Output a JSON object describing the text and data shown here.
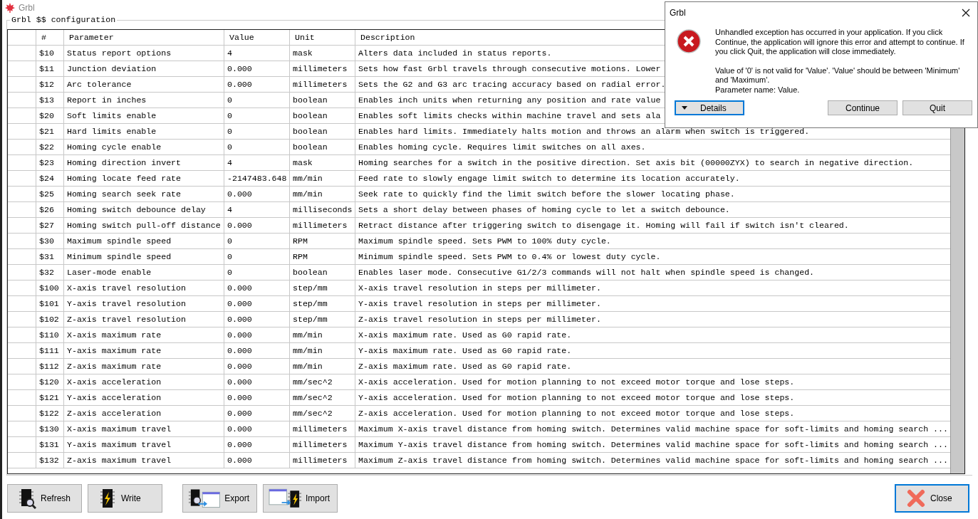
{
  "window": {
    "title": "Grbl"
  },
  "group_title": "Grbl $$ configuration",
  "table": {
    "columns": [
      "#",
      "Parameter",
      "Value",
      "Unit",
      "Description"
    ],
    "rows": [
      {
        "num": "$10",
        "parameter": "Status report options",
        "value": "4",
        "unit": "mask",
        "description": "Alters data included in status reports."
      },
      {
        "num": "$11",
        "parameter": "Junction deviation",
        "value": "0.000",
        "unit": "millimeters",
        "description": "Sets how fast Grbl travels through consecutive motions. Lower"
      },
      {
        "num": "$12",
        "parameter": "Arc tolerance",
        "value": "0.000",
        "unit": "millimeters",
        "description": "Sets the G2 and G3 arc tracing accuracy based on radial error."
      },
      {
        "num": "$13",
        "parameter": "Report in inches",
        "value": "0",
        "unit": "boolean",
        "description": "Enables inch units when returning any position and rate value"
      },
      {
        "num": "$20",
        "parameter": "Soft limits enable",
        "value": "0",
        "unit": "boolean",
        "description": "Enables soft limits checks within machine travel and sets ala"
      },
      {
        "num": "$21",
        "parameter": "Hard limits enable",
        "value": "0",
        "unit": "boolean",
        "description": "Enables hard limits. Immediately halts motion and throws an alarm when switch is triggered."
      },
      {
        "num": "$22",
        "parameter": "Homing cycle enable",
        "value": "0",
        "unit": "boolean",
        "description": "Enables homing cycle. Requires limit switches on all axes."
      },
      {
        "num": "$23",
        "parameter": "Homing direction invert",
        "value": "4",
        "unit": "mask",
        "description": "Homing searches for a switch in the positive direction. Set axis bit (00000ZYX) to search in negative direction."
      },
      {
        "num": "$24",
        "parameter": "Homing locate feed rate",
        "value": "-2147483.648",
        "unit": "mm/min",
        "description": "Feed rate to slowly engage limit switch to determine its location accurately."
      },
      {
        "num": "$25",
        "parameter": "Homing search seek rate",
        "value": "0.000",
        "unit": "mm/min",
        "description": "Seek rate to quickly find the limit switch before the slower locating phase."
      },
      {
        "num": "$26",
        "parameter": "Homing switch debounce delay",
        "value": "4",
        "unit": "milliseconds",
        "description": "Sets a short delay between phases of homing cycle to let a switch debounce."
      },
      {
        "num": "$27",
        "parameter": "Homing switch pull-off distance",
        "value": "0.000",
        "unit": "millimeters",
        "description": "Retract distance after triggering switch to disengage it. Homing will fail if switch isn't cleared."
      },
      {
        "num": "$30",
        "parameter": "Maximum spindle speed",
        "value": "0",
        "unit": "RPM",
        "description": "Maximum spindle speed. Sets PWM to 100% duty cycle."
      },
      {
        "num": "$31",
        "parameter": "Minimum spindle speed",
        "value": "0",
        "unit": "RPM",
        "description": "Minimum spindle speed. Sets PWM to 0.4% or lowest duty cycle."
      },
      {
        "num": "$32",
        "parameter": "Laser-mode enable",
        "value": "0",
        "unit": "boolean",
        "description": "Enables laser mode. Consecutive G1/2/3 commands will not halt when spindle speed is changed."
      },
      {
        "num": "$100",
        "parameter": "X-axis travel resolution",
        "value": "0.000",
        "unit": "step/mm",
        "description": "X-axis travel resolution in steps per millimeter."
      },
      {
        "num": "$101",
        "parameter": "Y-axis travel resolution",
        "value": "0.000",
        "unit": "step/mm",
        "description": "Y-axis travel resolution in steps per millimeter."
      },
      {
        "num": "$102",
        "parameter": "Z-axis travel resolution",
        "value": "0.000",
        "unit": "step/mm",
        "description": "Z-axis travel resolution in steps per millimeter."
      },
      {
        "num": "$110",
        "parameter": "X-axis maximum rate",
        "value": "0.000",
        "unit": "mm/min",
        "description": "X-axis maximum rate. Used as G0 rapid rate."
      },
      {
        "num": "$111",
        "parameter": "Y-axis maximum rate",
        "value": "0.000",
        "unit": "mm/min",
        "description": "Y-axis maximum rate. Used as G0 rapid rate."
      },
      {
        "num": "$112",
        "parameter": "Z-axis maximum rate",
        "value": "0.000",
        "unit": "mm/min",
        "description": "Z-axis maximum rate. Used as G0 rapid rate."
      },
      {
        "num": "$120",
        "parameter": "X-axis acceleration",
        "value": "0.000",
        "unit": "mm/sec^2",
        "description": "X-axis acceleration. Used for motion planning to not exceed motor torque and lose steps."
      },
      {
        "num": "$121",
        "parameter": "Y-axis acceleration",
        "value": "0.000",
        "unit": "mm/sec^2",
        "description": "Y-axis acceleration. Used for motion planning to not exceed motor torque and lose steps."
      },
      {
        "num": "$122",
        "parameter": "Z-axis acceleration",
        "value": "0.000",
        "unit": "mm/sec^2",
        "description": "Z-axis acceleration. Used for motion planning to not exceed motor torque and lose steps."
      },
      {
        "num": "$130",
        "parameter": "X-axis maximum travel",
        "value": "0.000",
        "unit": "millimeters",
        "description": "Maximum X-axis travel distance from homing switch. Determines valid machine space for soft-limits and homing search ..."
      },
      {
        "num": "$131",
        "parameter": "Y-axis maximum travel",
        "value": "0.000",
        "unit": "millimeters",
        "description": "Maximum Y-axis travel distance from homing switch. Determines valid machine space for soft-limits and homing search ..."
      },
      {
        "num": "$132",
        "parameter": "Z-axis maximum travel",
        "value": "0.000",
        "unit": "millimeters",
        "description": "Maximum Z-axis travel distance from homing switch. Determines valid machine space for soft-limits and homing search ..."
      }
    ]
  },
  "buttons": [
    {
      "label": "Refresh",
      "kind": "refresh"
    },
    {
      "label": "Write",
      "kind": "write"
    },
    {
      "label": "Export",
      "kind": "export"
    },
    {
      "label": "Import",
      "kind": "import"
    }
  ],
  "close_button": {
    "label": "Close",
    "default": true
  },
  "dialog": {
    "title": "Grbl",
    "message": "Unhandled exception has occurred in your application. If you click Continue, the application will ignore this error and attempt to continue. If you click Quit, the application will close immediately.",
    "detail_lines": [
      "Value of '0' is not valid for 'Value'. 'Value' should be between 'Minimum' and 'Maximum'.",
      "Parameter name: Value."
    ],
    "details_button": {
      "label": "Details",
      "default": true
    },
    "buttons": [
      {
        "label": "Continue",
        "default": false
      },
      {
        "label": "Quit",
        "default": false
      }
    ]
  }
}
